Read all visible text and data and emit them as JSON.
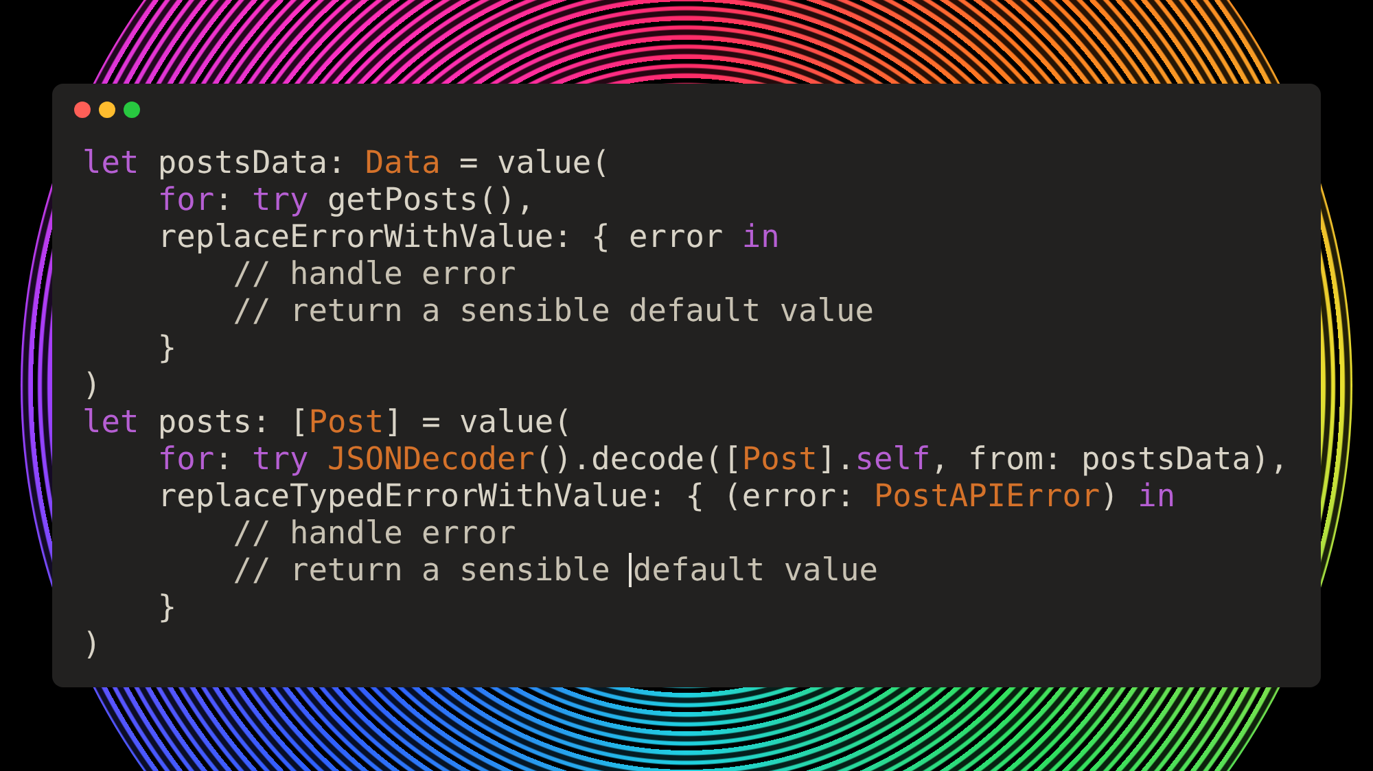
{
  "code_lines": [
    [
      {
        "kind": "keyword",
        "text": "let"
      },
      {
        "kind": "plain",
        "text": " postsData: "
      },
      {
        "kind": "type",
        "text": "Data"
      },
      {
        "kind": "plain",
        "text": " = value("
      }
    ],
    [
      {
        "kind": "keyword",
        "text": "    for"
      },
      {
        "kind": "plain",
        "text": ": "
      },
      {
        "kind": "keyword",
        "text": "try"
      },
      {
        "kind": "plain",
        "text": " getPosts(),"
      }
    ],
    [
      {
        "kind": "plain",
        "text": "    replaceErrorWithValue: { error "
      },
      {
        "kind": "keyword",
        "text": "in"
      }
    ],
    [
      {
        "kind": "comment",
        "text": "        // handle error"
      }
    ],
    [
      {
        "kind": "comment",
        "text": "        // return a sensible default value"
      }
    ],
    [
      {
        "kind": "plain",
        "text": "    }"
      }
    ],
    [
      {
        "kind": "plain",
        "text": ")"
      }
    ],
    [
      {
        "kind": "keyword",
        "text": "let"
      },
      {
        "kind": "plain",
        "text": " posts: ["
      },
      {
        "kind": "type",
        "text": "Post"
      },
      {
        "kind": "plain",
        "text": "] = value("
      }
    ],
    [
      {
        "kind": "keyword",
        "text": "    for"
      },
      {
        "kind": "plain",
        "text": ": "
      },
      {
        "kind": "keyword",
        "text": "try "
      },
      {
        "kind": "type",
        "text": "JSONDecoder"
      },
      {
        "kind": "plain",
        "text": "().decode(["
      },
      {
        "kind": "type",
        "text": "Post"
      },
      {
        "kind": "plain",
        "text": "]."
      },
      {
        "kind": "keyword",
        "text": "self"
      },
      {
        "kind": "plain",
        "text": ", from: postsData),"
      }
    ],
    [
      {
        "kind": "plain",
        "text": "    replaceTypedErrorWithValue: { (error: "
      },
      {
        "kind": "type",
        "text": "PostAPIError"
      },
      {
        "kind": "plain",
        "text": ") "
      },
      {
        "kind": "keyword",
        "text": "in"
      }
    ],
    [
      {
        "kind": "comment",
        "text": "        // handle error"
      }
    ],
    [
      {
        "kind": "comment",
        "text": "        // return a sensible "
      },
      {
        "kind": "cursor"
      },
      {
        "kind": "comment",
        "text": "default value"
      }
    ],
    [
      {
        "kind": "plain",
        "text": "    }"
      }
    ],
    [
      {
        "kind": "plain",
        "text": ")"
      }
    ]
  ]
}
